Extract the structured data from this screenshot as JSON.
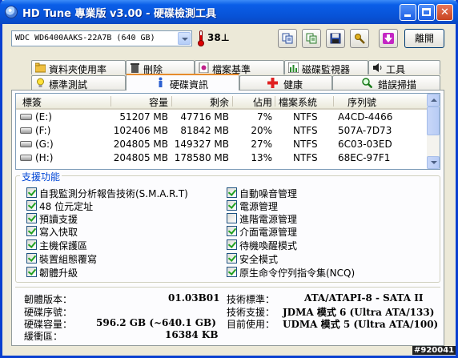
{
  "window": {
    "title": "HD Tune 專業版 v3.00 - 硬碟檢測工具"
  },
  "toolbar": {
    "drive": "WDC WD6400AAKS-22A7B  (640 GB)",
    "temperature": "38⊥",
    "exit_label": "離開"
  },
  "tabs_top": [
    {
      "label": "資料夾使用率"
    },
    {
      "label": "刪除"
    },
    {
      "label": "檔案基準"
    },
    {
      "label": "磁碟監視器"
    },
    {
      "label": "工具"
    }
  ],
  "tabs_bottom": [
    {
      "label": "標準測試"
    },
    {
      "label": "硬碟資訊"
    },
    {
      "label": "健康"
    },
    {
      "label": "錯誤掃描"
    }
  ],
  "partitions": {
    "columns": [
      "標簽",
      "容量",
      "剩余",
      "佔用",
      "檔案系統",
      "序列號"
    ],
    "rows": [
      {
        "label": "(E:)",
        "capacity": "51207 MB",
        "free": "47716 MB",
        "used": "7%",
        "fs": "NTFS",
        "serial": "A4CD-4466"
      },
      {
        "label": "(F:)",
        "capacity": "102406 MB",
        "free": "81842 MB",
        "used": "20%",
        "fs": "NTFS",
        "serial": "507A-7D73"
      },
      {
        "label": "(G:)",
        "capacity": "204805 MB",
        "free": "149327 MB",
        "used": "27%",
        "fs": "NTFS",
        "serial": "6C03-03ED"
      },
      {
        "label": "(H:)",
        "capacity": "204805 MB",
        "free": "178580 MB",
        "used": "13%",
        "fs": "NTFS",
        "serial": "68EC-97F1"
      }
    ]
  },
  "features": {
    "title": "支援功能",
    "left": [
      {
        "label": "自我監測分析報告技術(S.M.A.R.T)",
        "checked": true
      },
      {
        "label": "48 位元定址",
        "checked": true
      },
      {
        "label": "預讀支援",
        "checked": true
      },
      {
        "label": "寫入快取",
        "checked": true
      },
      {
        "label": "主機保護區",
        "checked": true
      },
      {
        "label": "裝置組態覆寫",
        "checked": true
      },
      {
        "label": "韌體升級",
        "checked": true
      }
    ],
    "right": [
      {
        "label": "自動噪音管理",
        "checked": true
      },
      {
        "label": "電源管理",
        "checked": true
      },
      {
        "label": "進階電源管理",
        "checked": false
      },
      {
        "label": "介面電源管理",
        "checked": true
      },
      {
        "label": "待機喚醒模式",
        "checked": true
      },
      {
        "label": "安全模式",
        "checked": true
      },
      {
        "label": "原生命令佇列指令集(NCQ)",
        "checked": true
      }
    ]
  },
  "info": {
    "firmware_label": "韌體版本：",
    "firmware": "01.03B01",
    "serial_label": "硬碟序號：",
    "serial": "",
    "capacity_label": "硬碟容量：",
    "capacity": "596.2 GB (~640.1 GB)",
    "buffer_label": "緩衝區：",
    "buffer": "16384 KB",
    "standard_label": "技術標準：",
    "standard": "ATA/ATAPI-8 - SATA II",
    "support_label": "技術支援：",
    "support": "JDMA 模式 6 (Ultra ATA/133)",
    "current_label": "目前使用：",
    "current": "UDMA 模式 5 (Ultra ATA/100)"
  },
  "watermark": "#920041"
}
